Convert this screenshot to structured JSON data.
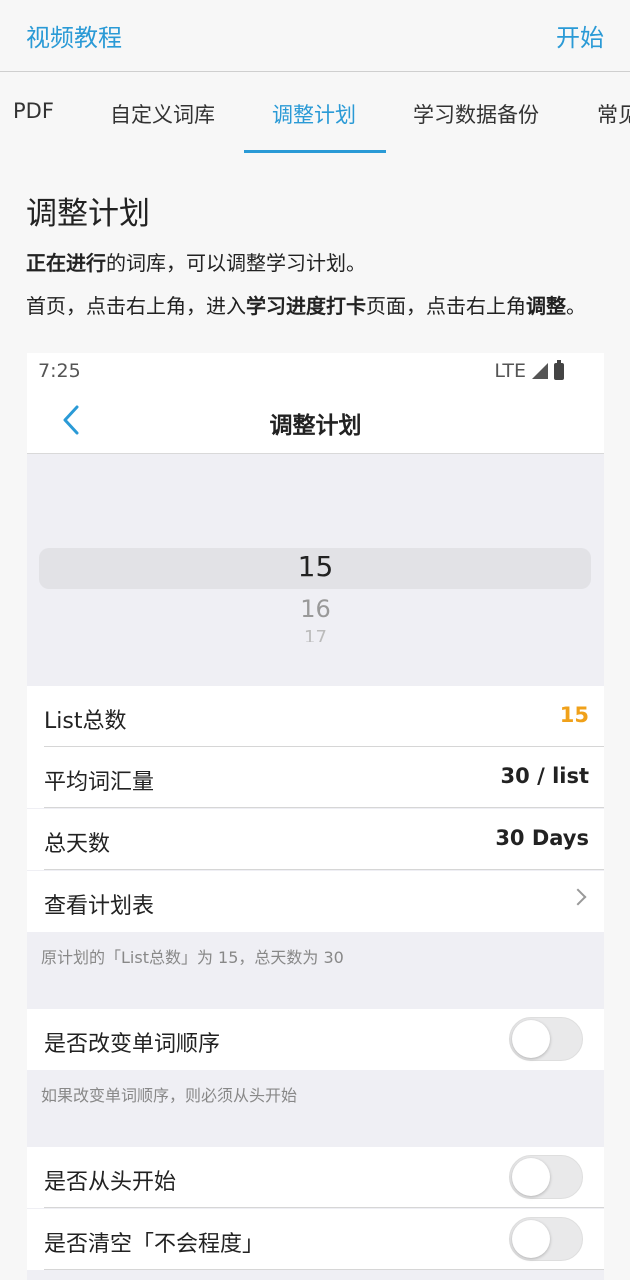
{
  "header": {
    "left_link": "视频教程",
    "right_link": "开始"
  },
  "tabs": [
    {
      "label": "PDF"
    },
    {
      "label": "自定义词库"
    },
    {
      "label": "调整计划"
    },
    {
      "label": "学习数据备份"
    },
    {
      "label": "常见"
    }
  ],
  "active_tab": "调整计划",
  "article": {
    "title": "调整计划",
    "p1_bold": "正在进行",
    "p1_rest": "的词库，可以调整学习计划。",
    "p2_a": "首页，点击右上角，进入",
    "p2_bold1": "学习进度打卡",
    "p2_b": "页面，点击右上角",
    "p2_bold2": "调整",
    "p2_end": "。"
  },
  "phone": {
    "status_time": "7:25",
    "status_network": "LTE",
    "nav_title": "调整计划",
    "picker": {
      "selected": "15",
      "next": "16",
      "next2": "17"
    },
    "rows": {
      "list_total": {
        "label": "List总数",
        "value": "15"
      },
      "avg_words": {
        "label": "平均词汇量",
        "value": "30 / list"
      },
      "total_days": {
        "label": "总天数",
        "value": "30 Days"
      },
      "view_schedule": {
        "label": "查看计划表"
      }
    },
    "note1": "原计划的「List总数」为 15，总天数为 30",
    "change_order": {
      "label": "是否改变单词顺序",
      "on": false
    },
    "note2": "如果改变单词顺序，则必须从头开始",
    "restart": {
      "label": "是否从头开始",
      "on": false
    },
    "clear_unknown": {
      "label": "是否清空「不会程度」",
      "on": false
    }
  },
  "colors": {
    "accent": "#2a9ad6",
    "orange": "#f0a11a"
  }
}
